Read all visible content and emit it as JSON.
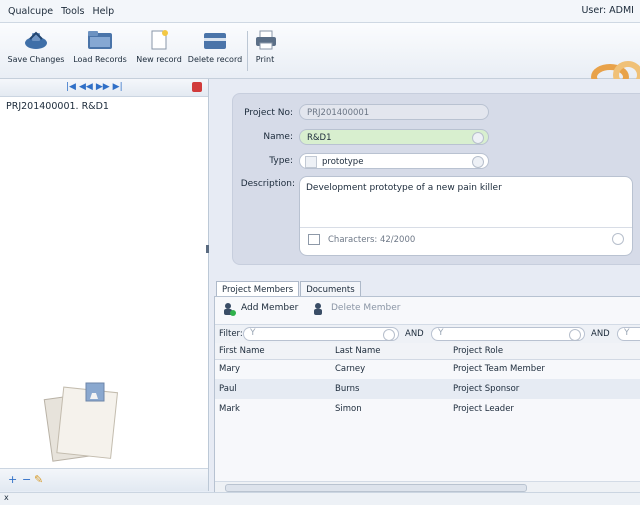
{
  "menu": {
    "items": [
      "Qualcupe",
      "Tools",
      "Help"
    ],
    "user": "User: ADMI"
  },
  "toolbar": {
    "buttons": [
      {
        "label": "Save Changes",
        "icon": "save-icon"
      },
      {
        "label": "Load Records",
        "icon": "folder-icon"
      },
      {
        "label": "New record",
        "icon": "new-record-icon"
      },
      {
        "label": "Delete record",
        "icon": "delete-record-icon"
      },
      {
        "label": "Print",
        "icon": "print-icon"
      }
    ]
  },
  "records": {
    "selected": "PRJ201400001. R&D1"
  },
  "form": {
    "project_no_label": "Project No:",
    "project_no": "PRJ201400001",
    "name_label": "Name:",
    "name": "R&D1",
    "type_label": "Type:",
    "type": "prototype",
    "description_label": "Description:",
    "description": "Development prototype of a new pain killer",
    "characters": "Characters: 42/2000"
  },
  "tabs": [
    "Project Members",
    "Documents"
  ],
  "members_toolbar": {
    "add": "Add Member",
    "delete": "Delete Member"
  },
  "filter": {
    "label": "Filter:",
    "and": "AND"
  },
  "table": {
    "headers": [
      "First Name",
      "Last Name",
      "Project Role"
    ],
    "rows": [
      [
        "Mary",
        "Carney",
        "Project Team Member"
      ],
      [
        "Paul",
        "Burns",
        "Project Sponsor"
      ],
      [
        "Mark",
        "Simon",
        "Project Leader"
      ]
    ]
  },
  "status": {
    "text": "x"
  },
  "colors": {
    "accent": "#2f6fc7",
    "name_field_bg": "#d8efcf",
    "logo": "#e8a24a"
  }
}
